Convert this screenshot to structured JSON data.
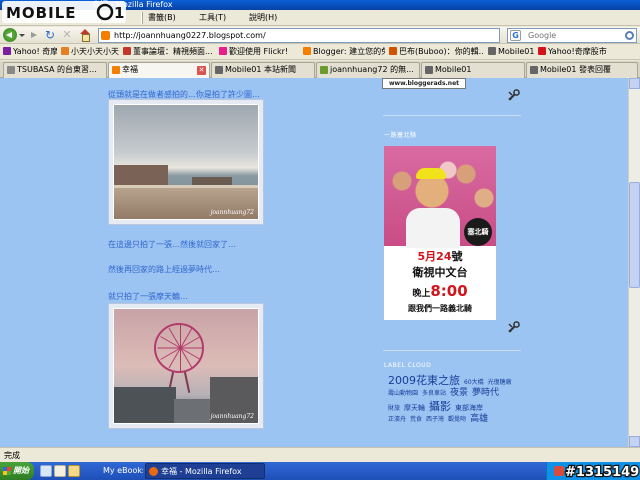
{
  "window": {
    "title": "幸福 - Mozilla Firefox"
  },
  "logo": {
    "text": "MOBILE01"
  },
  "menu": {
    "items": [
      "書籤(B)",
      "工具(T)",
      "說明(H)"
    ]
  },
  "nav": {
    "url": "http://joannhuang0227.blogspot.com/",
    "search_placeholder": "Google",
    "search_engine_icon": "G"
  },
  "bookmarks": [
    {
      "label": "Yahoo! 奇摩",
      "color": "#7a1fa2"
    },
    {
      "label": "小天小天小天",
      "color": "#e67e22"
    },
    {
      "label": "董事論壇：精視頻面...",
      "color": "#c0392b"
    },
    {
      "label": "歡迎使用 Flickr!",
      "color": "#e91e8c"
    },
    {
      "label": "Blogger: 建立您的免...",
      "color": "#f57d00"
    },
    {
      "label": "巴布(Buboo)：你的輯...",
      "color": "#d35400"
    },
    {
      "label": "Mobile01",
      "color": "#666666"
    },
    {
      "label": "Yahoo!奇摩股市",
      "color": "#d4141b"
    }
  ],
  "tabs": [
    {
      "label": "TSUBASA 的台東習...",
      "color": "#888888",
      "active": false
    },
    {
      "label": "幸福",
      "color": "#f57d00",
      "active": true
    },
    {
      "label": "Mobile01 本站新聞",
      "color": "#666666",
      "active": false
    },
    {
      "label": "joannhuang72 的無...",
      "color": "#6a9b2f",
      "active": false
    },
    {
      "label": "Mobile01",
      "color": "#666666",
      "active": false
    },
    {
      "label": "Mobile01 發表回覆",
      "color": "#666666",
      "active": false
    }
  ],
  "post": {
    "captions": [
      "從頭就是在做者感拍的…你是拍了許少圖…",
      "在這邊只拍了一張…然後就回家了…",
      "然後再回家的路上經過夢時代…",
      "就只拍了一張摩天輪…"
    ],
    "photo_watermark": "joannhuang72"
  },
  "sidebar": {
    "ads_text": "www.bloggerads.net",
    "poster_heading": "一路塞北騎",
    "poster": {
      "badge": "塞北騎",
      "date_num": "5月24",
      "date_suffix": "號",
      "channel": "衛視中文台",
      "time_prefix": "晚上",
      "time": "8:00",
      "slogan": "跟我們一路義北騎"
    },
    "label_cloud_heading": "LABEL CLOUD",
    "tags": [
      [
        {
          "t": "2009花東之旅",
          "s": 4
        },
        {
          "t": "60大橋",
          "s": 1
        },
        {
          "t": "光復糖廠",
          "s": 1
        }
      ],
      [
        {
          "t": "壽山動物園",
          "s": 1
        },
        {
          "t": "多良車站",
          "s": 1
        },
        {
          "t": "夜景",
          "s": 3
        },
        {
          "t": "夢時代",
          "s": 3
        }
      ],
      [
        {
          "t": "財旅",
          "s": 1
        },
        {
          "t": "摩天輪",
          "s": 2
        },
        {
          "t": "攝影",
          "s": 4
        },
        {
          "t": "東部海岸",
          "s": 2
        }
      ],
      [
        {
          "t": "正濱舟",
          "s": 1
        },
        {
          "t": "荒食",
          "s": 1
        },
        {
          "t": "西子灣",
          "s": 1
        },
        {
          "t": "觀覺吻",
          "s": 1
        },
        {
          "t": "高雄",
          "s": 3
        }
      ]
    ]
  },
  "status": {
    "text": "完成"
  },
  "taskbar": {
    "start": "開始",
    "tasks": [
      "My eBooks",
      "幸福 - Mozilla Firefox"
    ]
  },
  "watermark": {
    "text": "#1315149"
  }
}
